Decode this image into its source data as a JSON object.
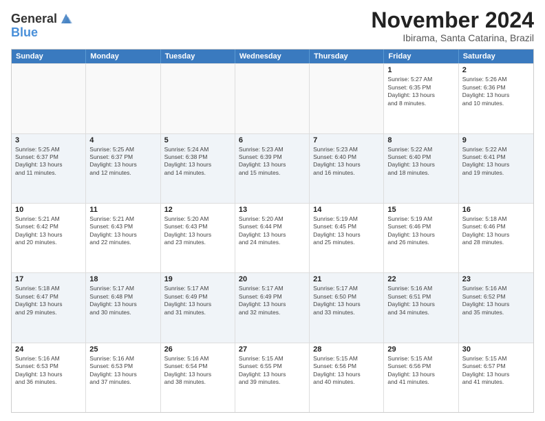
{
  "logo": {
    "general": "General",
    "blue": "Blue"
  },
  "title": "November 2024",
  "subtitle": "Ibirama, Santa Catarina, Brazil",
  "weekdays": [
    "Sunday",
    "Monday",
    "Tuesday",
    "Wednesday",
    "Thursday",
    "Friday",
    "Saturday"
  ],
  "weeks": [
    [
      {
        "day": "",
        "info": ""
      },
      {
        "day": "",
        "info": ""
      },
      {
        "day": "",
        "info": ""
      },
      {
        "day": "",
        "info": ""
      },
      {
        "day": "",
        "info": ""
      },
      {
        "day": "1",
        "info": "Sunrise: 5:27 AM\nSunset: 6:35 PM\nDaylight: 13 hours\nand 8 minutes."
      },
      {
        "day": "2",
        "info": "Sunrise: 5:26 AM\nSunset: 6:36 PM\nDaylight: 13 hours\nand 10 minutes."
      }
    ],
    [
      {
        "day": "3",
        "info": "Sunrise: 5:25 AM\nSunset: 6:37 PM\nDaylight: 13 hours\nand 11 minutes."
      },
      {
        "day": "4",
        "info": "Sunrise: 5:25 AM\nSunset: 6:37 PM\nDaylight: 13 hours\nand 12 minutes."
      },
      {
        "day": "5",
        "info": "Sunrise: 5:24 AM\nSunset: 6:38 PM\nDaylight: 13 hours\nand 14 minutes."
      },
      {
        "day": "6",
        "info": "Sunrise: 5:23 AM\nSunset: 6:39 PM\nDaylight: 13 hours\nand 15 minutes."
      },
      {
        "day": "7",
        "info": "Sunrise: 5:23 AM\nSunset: 6:40 PM\nDaylight: 13 hours\nand 16 minutes."
      },
      {
        "day": "8",
        "info": "Sunrise: 5:22 AM\nSunset: 6:40 PM\nDaylight: 13 hours\nand 18 minutes."
      },
      {
        "day": "9",
        "info": "Sunrise: 5:22 AM\nSunset: 6:41 PM\nDaylight: 13 hours\nand 19 minutes."
      }
    ],
    [
      {
        "day": "10",
        "info": "Sunrise: 5:21 AM\nSunset: 6:42 PM\nDaylight: 13 hours\nand 20 minutes."
      },
      {
        "day": "11",
        "info": "Sunrise: 5:21 AM\nSunset: 6:43 PM\nDaylight: 13 hours\nand 22 minutes."
      },
      {
        "day": "12",
        "info": "Sunrise: 5:20 AM\nSunset: 6:43 PM\nDaylight: 13 hours\nand 23 minutes."
      },
      {
        "day": "13",
        "info": "Sunrise: 5:20 AM\nSunset: 6:44 PM\nDaylight: 13 hours\nand 24 minutes."
      },
      {
        "day": "14",
        "info": "Sunrise: 5:19 AM\nSunset: 6:45 PM\nDaylight: 13 hours\nand 25 minutes."
      },
      {
        "day": "15",
        "info": "Sunrise: 5:19 AM\nSunset: 6:46 PM\nDaylight: 13 hours\nand 26 minutes."
      },
      {
        "day": "16",
        "info": "Sunrise: 5:18 AM\nSunset: 6:46 PM\nDaylight: 13 hours\nand 28 minutes."
      }
    ],
    [
      {
        "day": "17",
        "info": "Sunrise: 5:18 AM\nSunset: 6:47 PM\nDaylight: 13 hours\nand 29 minutes."
      },
      {
        "day": "18",
        "info": "Sunrise: 5:17 AM\nSunset: 6:48 PM\nDaylight: 13 hours\nand 30 minutes."
      },
      {
        "day": "19",
        "info": "Sunrise: 5:17 AM\nSunset: 6:49 PM\nDaylight: 13 hours\nand 31 minutes."
      },
      {
        "day": "20",
        "info": "Sunrise: 5:17 AM\nSunset: 6:49 PM\nDaylight: 13 hours\nand 32 minutes."
      },
      {
        "day": "21",
        "info": "Sunrise: 5:17 AM\nSunset: 6:50 PM\nDaylight: 13 hours\nand 33 minutes."
      },
      {
        "day": "22",
        "info": "Sunrise: 5:16 AM\nSunset: 6:51 PM\nDaylight: 13 hours\nand 34 minutes."
      },
      {
        "day": "23",
        "info": "Sunrise: 5:16 AM\nSunset: 6:52 PM\nDaylight: 13 hours\nand 35 minutes."
      }
    ],
    [
      {
        "day": "24",
        "info": "Sunrise: 5:16 AM\nSunset: 6:53 PM\nDaylight: 13 hours\nand 36 minutes."
      },
      {
        "day": "25",
        "info": "Sunrise: 5:16 AM\nSunset: 6:53 PM\nDaylight: 13 hours\nand 37 minutes."
      },
      {
        "day": "26",
        "info": "Sunrise: 5:16 AM\nSunset: 6:54 PM\nDaylight: 13 hours\nand 38 minutes."
      },
      {
        "day": "27",
        "info": "Sunrise: 5:15 AM\nSunset: 6:55 PM\nDaylight: 13 hours\nand 39 minutes."
      },
      {
        "day": "28",
        "info": "Sunrise: 5:15 AM\nSunset: 6:56 PM\nDaylight: 13 hours\nand 40 minutes."
      },
      {
        "day": "29",
        "info": "Sunrise: 5:15 AM\nSunset: 6:56 PM\nDaylight: 13 hours\nand 41 minutes."
      },
      {
        "day": "30",
        "info": "Sunrise: 5:15 AM\nSunset: 6:57 PM\nDaylight: 13 hours\nand 41 minutes."
      }
    ]
  ]
}
